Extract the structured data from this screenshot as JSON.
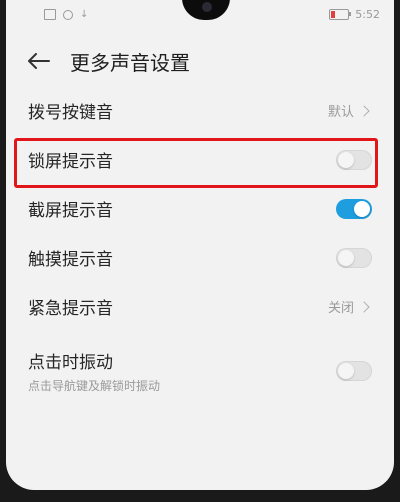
{
  "status_bar": {
    "time": "5:52",
    "icons": [
      "sim-icon",
      "notification-icon",
      "download-icon"
    ],
    "battery_level_fraction": 0.2,
    "battery_color": "#e04040"
  },
  "header": {
    "back_icon": "arrow-left-icon",
    "title": "更多声音设置"
  },
  "rows": [
    {
      "label": "拨号按键音",
      "type": "value",
      "value": "默认"
    },
    {
      "label": "锁屏提示音",
      "type": "toggle",
      "on": false,
      "highlighted": true
    },
    {
      "label": "截屏提示音",
      "type": "toggle",
      "on": true
    },
    {
      "label": "触摸提示音",
      "type": "toggle",
      "on": false
    },
    {
      "label": "紧急提示音",
      "type": "value",
      "value": "关闭"
    },
    {
      "label": "点击时振动",
      "sublabel": "点击导航键及解锁时振动",
      "type": "toggle",
      "on": false
    }
  ],
  "colors": {
    "accent": "#1e9ddf",
    "highlight_border": "#e0161a",
    "background": "#f2f2f2"
  }
}
